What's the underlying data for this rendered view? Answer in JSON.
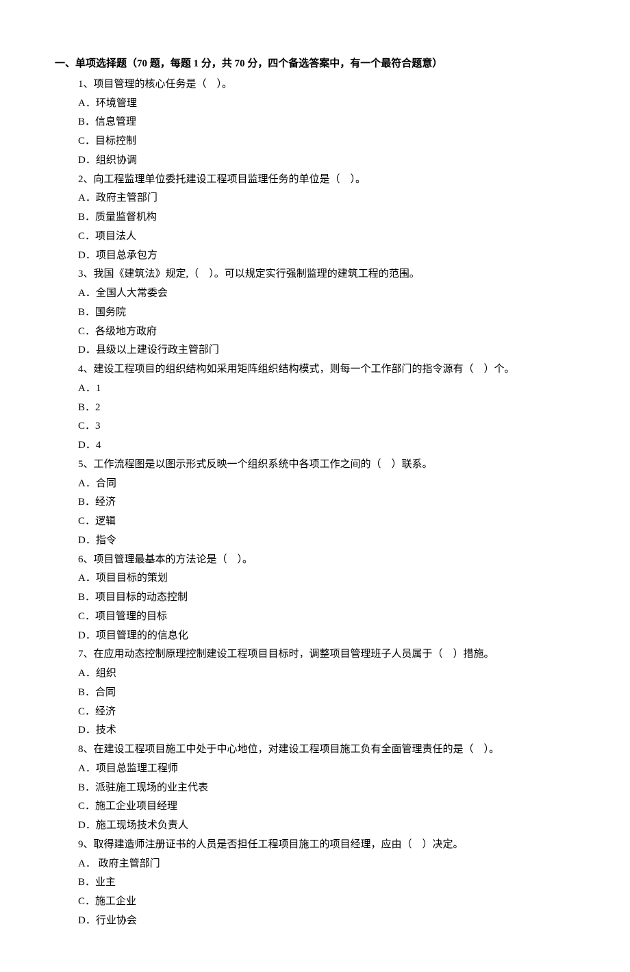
{
  "heading": "一、单项选择题（70 题，每题 1 分，共 70 分，四个备选答案中，有一个最符合题意）",
  "questions": [
    {
      "stem": "1、项目管理的核心任务是（　）。",
      "options": [
        "A．环境管理",
        "B．信息管理",
        "C．目标控制",
        "D．组织协调"
      ]
    },
    {
      "stem": "2、向工程监理单位委托建设工程项目监理任务的单位是（　）。",
      "options": [
        "A．政府主管部门",
        "B．质量监督机构",
        "C．项目法人",
        "D．项目总承包方"
      ]
    },
    {
      "stem": "3、我国《建筑法》规定,（　）。可以规定实行强制监理的建筑工程的范围。",
      "options": [
        "A．全国人大常委会",
        "B．国务院",
        "C．各级地方政府",
        "D．县级以上建设行政主管部门"
      ]
    },
    {
      "stem": "4、建设工程项目的组织结构如采用矩阵组织结构模式，则每一个工作部门的指令源有（　）个。",
      "options": [
        "A．1",
        "B．2",
        "C．3",
        "D．4"
      ]
    },
    {
      "stem": "5、工作流程图是以图示形式反映一个组织系统中各项工作之间的（　）联系。",
      "options": [
        "A．合同",
        "B．经济",
        "C．逻辑",
        "D．指令"
      ]
    },
    {
      "stem": "6、项目管理最基本的方法论是（　）。",
      "options": [
        "A．项目目标的策划",
        "B．项目目标的动态控制",
        "C．项目管理的目标",
        "D．项目管理的的信息化"
      ]
    },
    {
      "stem": "7、在应用动态控制原理控制建设工程项目目标时，调整项目管理班子人员属于（　）措施。",
      "options": [
        "A．组织",
        "B．合同",
        "C．经济",
        "D．技术"
      ]
    },
    {
      "stem": "8、在建设工程项目施工中处于中心地位，对建设工程项目施工负有全面管理责任的是（　）。",
      "options": [
        "A．项目总监理工程师",
        "B．派驻施工现场的业主代表",
        "C．施工企业项目经理",
        "D．施工现场技术负责人"
      ]
    },
    {
      "stem": "9、取得建造师注册证书的人员是否担任工程项目施工的项目经理，应由（　）决定。",
      "options": [
        "A． 政府主管部门",
        "B．业主",
        "C．施工企业",
        "D．行业协会"
      ]
    }
  ]
}
